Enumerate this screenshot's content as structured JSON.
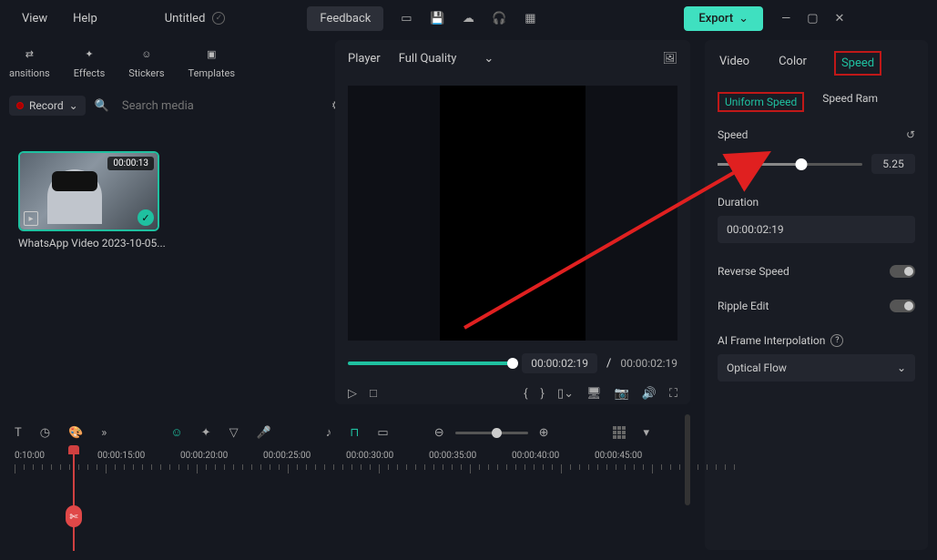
{
  "menu": {
    "view": "View",
    "help": "Help"
  },
  "project_title": "Untitled",
  "feedback": "Feedback",
  "export": "Export",
  "media_tabs": {
    "transitions": "ansitions",
    "effects": "Effects",
    "stickers": "Stickers",
    "templates": "Templates"
  },
  "record_label": "Record",
  "search_placeholder": "Search media",
  "clip": {
    "duration": "00:00:13",
    "name": "WhatsApp Video 2023-10-05..."
  },
  "player": {
    "label": "Player",
    "quality": "Full Quality",
    "current": "00:00:02:19",
    "total": "00:00:02:19"
  },
  "right_tabs": {
    "video": "Video",
    "color": "Color",
    "speed": "Speed"
  },
  "speed_sub": {
    "uniform": "Uniform Speed",
    "ramp": "Speed Ram"
  },
  "speed_section": {
    "label": "Speed",
    "value": "5.25",
    "duration_label": "Duration",
    "duration_value": "00:00:02:19",
    "reverse": "Reverse Speed",
    "ripple": "Ripple Edit",
    "interp_label": "AI Frame Interpolation",
    "interp_value": "Optical Flow"
  },
  "timeline": {
    "labels": [
      "0:10:00",
      "00:00:15:00",
      "00:00:20:00",
      "00:00:25:00",
      "00:00:30:00",
      "00:00:35:00",
      "00:00:40:00",
      "00:00:45:00"
    ]
  }
}
